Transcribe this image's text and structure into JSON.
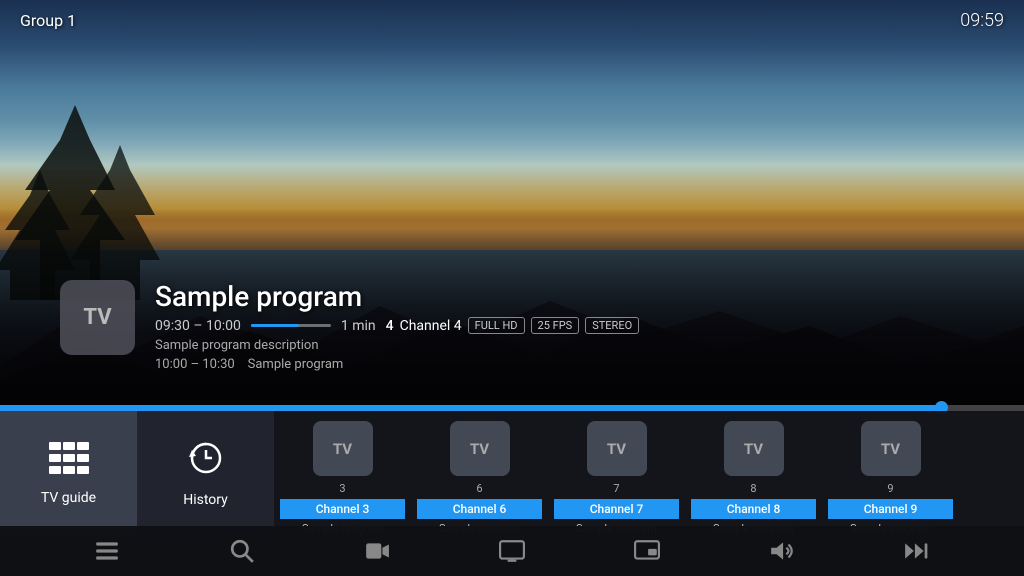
{
  "topBar": {
    "group": "Group 1",
    "clock": "09:59"
  },
  "program": {
    "logo": "TV",
    "title": "Sample program",
    "timeRange": "09:30 – 10:00",
    "progressPercent": 60,
    "duration": "1 min",
    "channelNum": "4",
    "channelName": "Channel 4",
    "badges": [
      "FULL HD",
      "25 FPS",
      "STEREO"
    ],
    "description": "Sample program description",
    "nextTime": "10:00 – 10:30",
    "nextTitle": "Sample program"
  },
  "navTiles": [
    {
      "id": "tv-guide",
      "label": "TV guide",
      "icon": "grid"
    },
    {
      "id": "history",
      "label": "History",
      "icon": "history"
    }
  ],
  "channels": [
    {
      "num": "3",
      "name": "Channel 3",
      "program": "Sample program"
    },
    {
      "num": "6",
      "name": "Channel 6",
      "program": "Sample program"
    },
    {
      "num": "7",
      "name": "Channel 7",
      "program": "Sample program"
    },
    {
      "num": "8",
      "name": "Channel 8",
      "program": "Sample program"
    },
    {
      "num": "9",
      "name": "Channel 9",
      "program": "Sample program"
    }
  ],
  "bottomNav": [
    {
      "id": "menu",
      "icon": "menu"
    },
    {
      "id": "search",
      "icon": "search"
    },
    {
      "id": "record",
      "icon": "videocam"
    },
    {
      "id": "screen",
      "icon": "screen"
    },
    {
      "id": "pip",
      "icon": "pip"
    },
    {
      "id": "volume",
      "icon": "volume"
    },
    {
      "id": "forward",
      "icon": "forward"
    }
  ],
  "colors": {
    "accent": "#2196F3",
    "tileActive": "rgba(60,65,80,0.95)",
    "channelNameBg": "#2196F3"
  }
}
